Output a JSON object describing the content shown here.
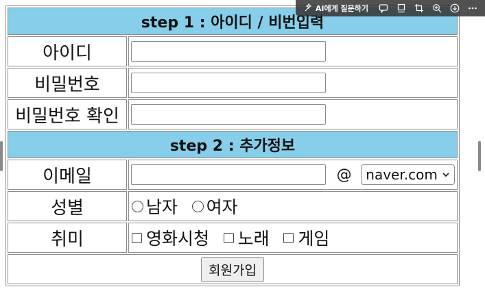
{
  "toolbar": {
    "ask_ai_label": "AI에게 질문하기",
    "icons": [
      "ai-sparkle-icon",
      "comment-icon",
      "note-icon",
      "crop-icon",
      "zoom-icon",
      "download-icon",
      "more-icon"
    ]
  },
  "form": {
    "step1_title": "step 1 : 아이디 / 비번입력",
    "id_label": "아이디",
    "pw_label": "비밀번호",
    "pw_confirm_label": "비밀번호 확인",
    "id_value": "",
    "pw_value": "",
    "pw_confirm_value": "",
    "step2_title": "step 2 : 추가정보",
    "email_label": "이메일",
    "email_value": "",
    "at_sign": "@",
    "domain_selected": "naver.com",
    "gender_label": "성별",
    "gender_options": [
      "남자",
      "여자"
    ],
    "hobby_label": "취미",
    "hobby_options": [
      "영화시청",
      "노래",
      "게임"
    ],
    "submit_label": "회원가입"
  },
  "colors": {
    "section_header_bg": "#87ceeb",
    "border": "#8c8c8c"
  }
}
